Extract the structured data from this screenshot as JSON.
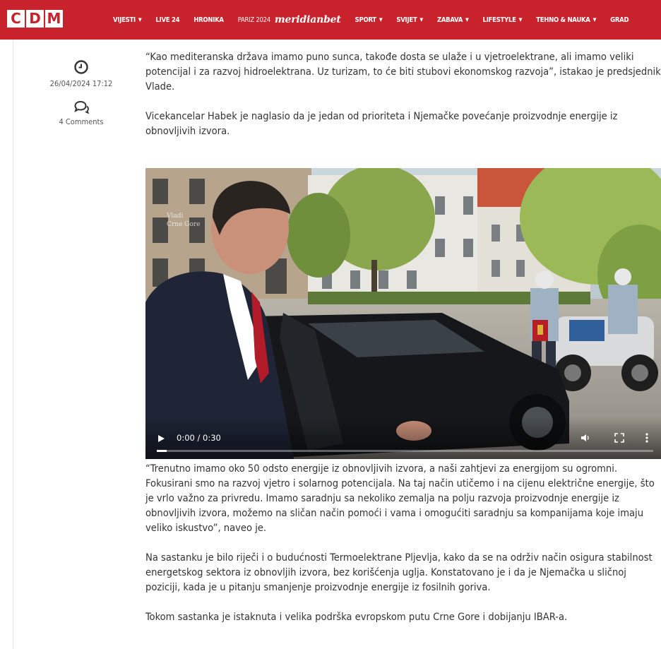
{
  "site": {
    "logo_letters": [
      "C",
      "D",
      "M"
    ]
  },
  "nav": {
    "items": [
      {
        "label": "VIJESTI",
        "dropdown": true
      },
      {
        "label": "LIVE 24",
        "dropdown": false
      },
      {
        "label": "HRONIKA",
        "dropdown": false
      },
      {
        "label": "PARIZ 2024",
        "dropdown": false
      }
    ],
    "brand": "meridianbet",
    "items_after": [
      {
        "label": "SPORT",
        "dropdown": true
      },
      {
        "label": "SVIJET",
        "dropdown": true
      },
      {
        "label": "ZABAVA",
        "dropdown": true
      },
      {
        "label": "LIFESTYLE",
        "dropdown": true
      },
      {
        "label": "TEHNO & NAUKA",
        "dropdown": true
      },
      {
        "label": "GRAD",
        "dropdown": false
      }
    ],
    "accent_color": "#c8232c"
  },
  "meta": {
    "date": "26/04/2024 17:12",
    "date_icon": "clock-icon",
    "comments": "4 Comments",
    "comments_icon": "comments-icon"
  },
  "article": {
    "paragraphs_top": [
      "“Kao mediteranska država imamo puno sunca, takođe dosta se ulaže i u vjetroelektrane, ali imamo veliki potencijal i za razvoj hidroelektrana. Uz turizam, to će biti stubovi ekonomskog razvoja”, istakao je predsjednik Vlade.",
      "Vicekancelar Habek je naglasio da je jedan od prioriteta i Njemačke povećanje proizvodnje energije iz obnovljivih izvora."
    ],
    "paragraphs_bottom": [
      "“Trenutno imamo oko 50 odsto energije iz obnovljivih izvora, a naši zahtjevi za energijom su ogromni. Fokusirani smo na razvoj vjetro i solarnog potencijala. Na taj način utičemo i na cijenu električne energije, što je vrlo važno za privredu. Imamo saradnju sa nekoliko zemalja na polju razvoja proizvodnje energije iz obnovljivih izvora, možemo na sličan način pomoći i vama i omogućiti saradnju sa kompanijama koje imaju veliko iskustvo”, naveo je.",
      "Na sastanku je bilo riječi i o budućnosti Termoelektrane Pljevlja, kako da se na održiv način osigura stabilnost energetskog sektora iz obnovljih izvora, bez korišćenja uglja. Konstatovano je i da je Njemačka u sličnoj poziciji, kada je u pitanju smanjenje proizvodnje energije iz fosilnih goriva.",
      "Tokom sastanka je istaknuta i velika podrška evropskom putu Crne Gore i dobijanju IBAR-a."
    ]
  },
  "video": {
    "time": "0:00 / 0:30",
    "progress_fraction": 0.0,
    "controls_icons": [
      "play-icon",
      "volume-icon",
      "fullscreen-icon",
      "more-options-icon"
    ]
  }
}
